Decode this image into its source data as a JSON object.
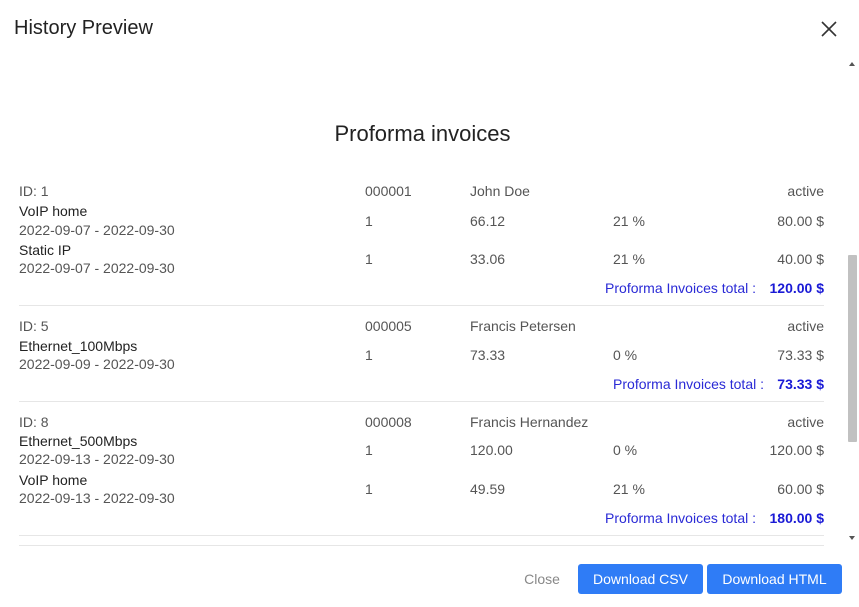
{
  "dialog": {
    "title": "History Preview",
    "close_icon": "close-icon"
  },
  "document": {
    "title": "Proforma invoices",
    "total_label": "Proforma Invoices total :",
    "invoices": [
      {
        "id": "ID: 1",
        "number": "000001",
        "customer": "John Doe",
        "status": "active",
        "items": [
          {
            "name": "VoIP home",
            "period": "2022-09-07 - 2022-09-30",
            "qty": "1",
            "price": "66.12",
            "vat": "21 %",
            "amount": "80.00 $"
          },
          {
            "name": "Static IP",
            "period": "2022-09-07 - 2022-09-30",
            "qty": "1",
            "price": "33.06",
            "vat": "21 %",
            "amount": "40.00 $"
          }
        ],
        "total": "120.00 $"
      },
      {
        "id": "ID: 5",
        "number": "000005",
        "customer": "Francis Petersen",
        "status": "active",
        "items": [
          {
            "name": "Ethernet_100Mbps",
            "period": "2022-09-09 - 2022-09-30",
            "qty": "1",
            "price": "73.33",
            "vat": "0 %",
            "amount": "73.33 $"
          }
        ],
        "total": "73.33 $"
      },
      {
        "id": "ID: 8",
        "number": "000008",
        "customer": "Francis Hernandez",
        "status": "active",
        "items": [
          {
            "name": "Ethernet_500Mbps",
            "period": "2022-09-13 - 2022-09-30",
            "qty": "1",
            "price": "120.00",
            "vat": "0 %",
            "amount": "120.00 $"
          },
          {
            "name": "VoIP home",
            "period": "2022-09-13 - 2022-09-30",
            "qty": "1",
            "price": "49.59",
            "vat": "21 %",
            "amount": "60.00 $"
          }
        ],
        "total": "180.00 $"
      }
    ]
  },
  "footer": {
    "close_label": "Close",
    "csv_label": "Download CSV",
    "html_label": "Download HTML"
  },
  "colors": {
    "primary_button": "#2f7cf6",
    "total_text": "#1a1ad6"
  }
}
